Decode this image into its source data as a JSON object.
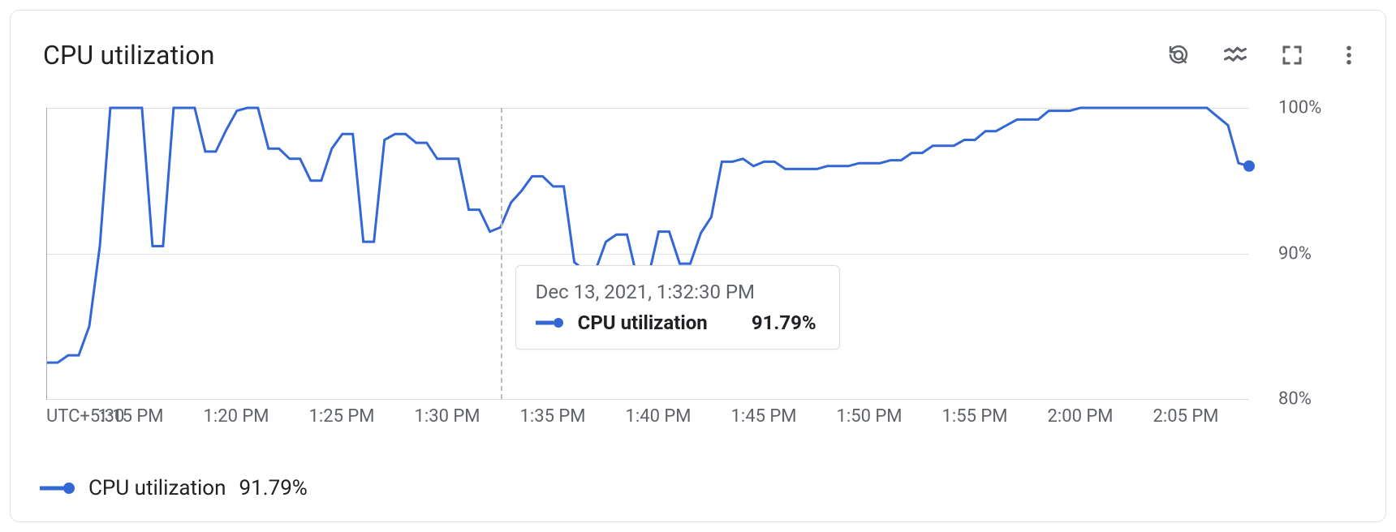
{
  "header": {
    "title": "CPU utilization"
  },
  "icons": {
    "reset_zoom": "reset-zoom-icon",
    "legend_toggle": "legend-toggle-icon",
    "fullscreen": "fullscreen-icon",
    "more": "more-icon"
  },
  "tooltip": {
    "timestamp": "Dec 13, 2021, 1:32:30 PM",
    "series_label": "CPU utilization",
    "value": "91.79%"
  },
  "legend": {
    "series_label": "CPU utilization",
    "value": "91.79%"
  },
  "chart_data": {
    "type": "line",
    "title": "CPU utilization",
    "xlabel": "",
    "ylabel": "",
    "ylim": [
      80,
      100
    ],
    "y_ticks": [
      "100%",
      "90%",
      "80%"
    ],
    "x_tz_label": "UTC+5:30",
    "x_ticks": [
      "1:15 PM",
      "1:20 PM",
      "1:25 PM",
      "1:30 PM",
      "1:35 PM",
      "1:40 PM",
      "1:45 PM",
      "1:50 PM",
      "1:55 PM",
      "2:00 PM",
      "2:05 PM"
    ],
    "hover_x": "1:32:30 PM",
    "hover_value": 91.79,
    "series": [
      {
        "name": "CPU utilization",
        "color": "#3367d6",
        "x": [
          "1:11:00",
          "1:11:30",
          "1:12:00",
          "1:12:30",
          "1:13:00",
          "1:13:30",
          "1:14:00",
          "1:14:30",
          "1:15:00",
          "1:15:30",
          "1:16:00",
          "1:16:30",
          "1:17:00",
          "1:17:30",
          "1:18:00",
          "1:18:30",
          "1:19:00",
          "1:19:30",
          "1:20:00",
          "1:20:30",
          "1:21:00",
          "1:21:30",
          "1:22:00",
          "1:22:30",
          "1:23:00",
          "1:23:30",
          "1:24:00",
          "1:24:30",
          "1:25:00",
          "1:25:30",
          "1:26:00",
          "1:26:30",
          "1:27:00",
          "1:27:30",
          "1:28:00",
          "1:28:30",
          "1:29:00",
          "1:29:30",
          "1:30:00",
          "1:30:30",
          "1:31:00",
          "1:31:30",
          "1:32:00",
          "1:32:30",
          "1:33:00",
          "1:33:30",
          "1:34:00",
          "1:34:30",
          "1:35:00",
          "1:35:30",
          "1:36:00",
          "1:36:30",
          "1:37:00",
          "1:37:30",
          "1:38:00",
          "1:38:30",
          "1:39:00",
          "1:39:30",
          "1:40:00",
          "1:40:30",
          "1:41:00",
          "1:41:30",
          "1:42:00",
          "1:42:30",
          "1:43:00",
          "1:43:30",
          "1:44:00",
          "1:44:30",
          "1:45:00",
          "1:45:30",
          "1:46:00",
          "1:46:30",
          "1:47:00",
          "1:47:30",
          "1:48:00",
          "1:48:30",
          "1:49:00",
          "1:49:30",
          "1:50:00",
          "1:50:30",
          "1:51:00",
          "1:51:30",
          "1:52:00",
          "1:52:30",
          "1:53:00",
          "1:53:30",
          "1:54:00",
          "1:54:30",
          "1:55:00",
          "1:55:30",
          "1:56:00",
          "1:56:30",
          "1:57:00",
          "1:57:30",
          "1:58:00",
          "1:58:30",
          "1:59:00",
          "1:59:30",
          "2:00:00",
          "2:00:30",
          "2:01:00",
          "2:01:30",
          "2:02:00",
          "2:02:30",
          "2:03:00",
          "2:03:30",
          "2:04:00",
          "2:04:30",
          "2:05:00",
          "2:05:30",
          "2:06:00",
          "2:06:30",
          "2:07:00",
          "2:07:30",
          "2:08:00"
        ],
        "values": [
          82.5,
          82.5,
          83.0,
          83.0,
          85.0,
          90.5,
          100.0,
          100.0,
          100.0,
          100.0,
          90.5,
          90.5,
          100.0,
          100.0,
          100.0,
          97.0,
          97.0,
          98.5,
          99.8,
          100.0,
          100.0,
          97.2,
          97.2,
          96.5,
          96.5,
          95.0,
          95.0,
          97.2,
          98.2,
          98.2,
          90.8,
          90.8,
          97.8,
          98.2,
          98.2,
          97.6,
          97.6,
          96.5,
          96.5,
          96.5,
          93.0,
          93.0,
          91.5,
          91.79,
          93.5,
          94.3,
          95.3,
          95.3,
          94.6,
          94.6,
          89.4,
          88.8,
          88.8,
          90.8,
          91.3,
          91.3,
          88.2,
          88.3,
          91.5,
          91.5,
          89.3,
          89.3,
          91.4,
          92.5,
          96.3,
          96.3,
          96.5,
          96.0,
          96.3,
          96.3,
          95.8,
          95.8,
          95.8,
          95.8,
          96.0,
          96.0,
          96.0,
          96.2,
          96.2,
          96.2,
          96.4,
          96.4,
          96.9,
          96.9,
          97.4,
          97.4,
          97.4,
          97.8,
          97.8,
          98.4,
          98.4,
          98.8,
          99.2,
          99.2,
          99.2,
          99.8,
          99.8,
          99.8,
          100.0,
          100.0,
          100.0,
          100.0,
          100.0,
          100.0,
          100.0,
          100.0,
          100.0,
          100.0,
          100.0,
          100.0,
          100.0,
          99.4,
          98.8,
          96.2,
          96.0
        ]
      }
    ]
  }
}
